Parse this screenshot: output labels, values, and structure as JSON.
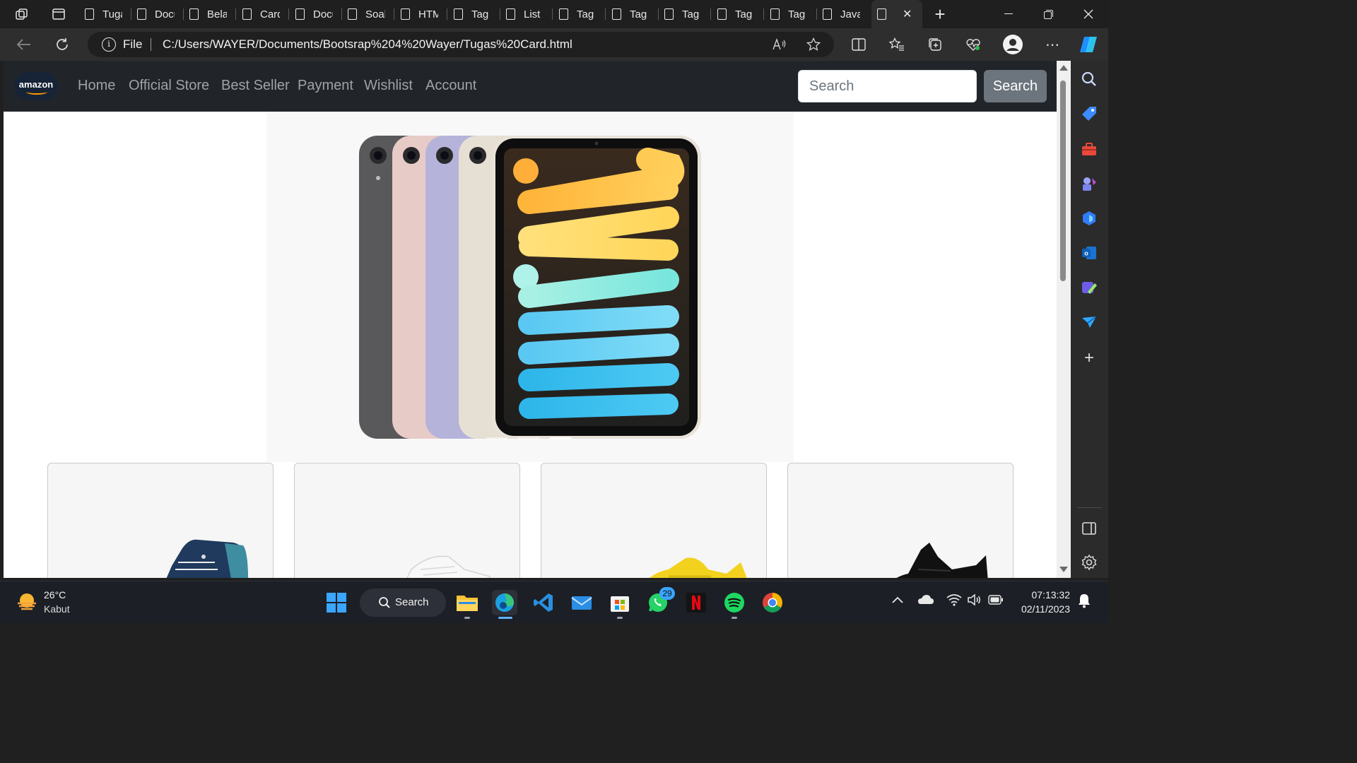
{
  "tabs": [
    {
      "title": "Tuga"
    },
    {
      "title": "Docu"
    },
    {
      "title": "Bela"
    },
    {
      "title": "Card"
    },
    {
      "title": "Docu"
    },
    {
      "title": "Soal"
    },
    {
      "title": "HTM"
    },
    {
      "title": "Tag"
    },
    {
      "title": "List"
    },
    {
      "title": "Tag"
    },
    {
      "title": "Tag"
    },
    {
      "title": "Tag"
    },
    {
      "title": "Tag"
    },
    {
      "title": "Tag"
    },
    {
      "title": "Java"
    }
  ],
  "addressbar": {
    "scheme_label": "File",
    "url": "C:/Users/WAYER/Documents/Bootsrap%204%20Wayer/Tugas%20Card.html"
  },
  "page": {
    "logo_text": "amazon",
    "nav_links": [
      "Home",
      "Official Store",
      "Best Seller",
      "Payment",
      "Wishlist",
      "Account"
    ],
    "search_placeholder": "Search",
    "search_button": "Search",
    "carousel": {
      "slide_count": 3,
      "active_slide": 2,
      "product": "ipad-mini",
      "ipad_colors": [
        "#5e5e60",
        "#e9cdc8",
        "#b9b7dd",
        "#e8e1d6"
      ]
    },
    "cards": [
      {
        "product": "navy-high-top-sneaker",
        "color": "#1f3a5c"
      },
      {
        "product": "white-sneaker",
        "color": "#f2f2f2"
      },
      {
        "product": "yellow-sneaker",
        "color": "#f2d21e"
      },
      {
        "product": "black-sneaker",
        "color": "#111111"
      }
    ]
  },
  "taskbar": {
    "weather": {
      "temp": "26°C",
      "condition": "Kabut"
    },
    "search_label": "Search",
    "whatsapp_badge": "29",
    "time": "07:13:32",
    "date": "02/11/2023"
  },
  "colors": {
    "navbar_bg": "#212529",
    "search_btn_bg": "#6c757d",
    "edge_accent": "#2ea0ff"
  }
}
